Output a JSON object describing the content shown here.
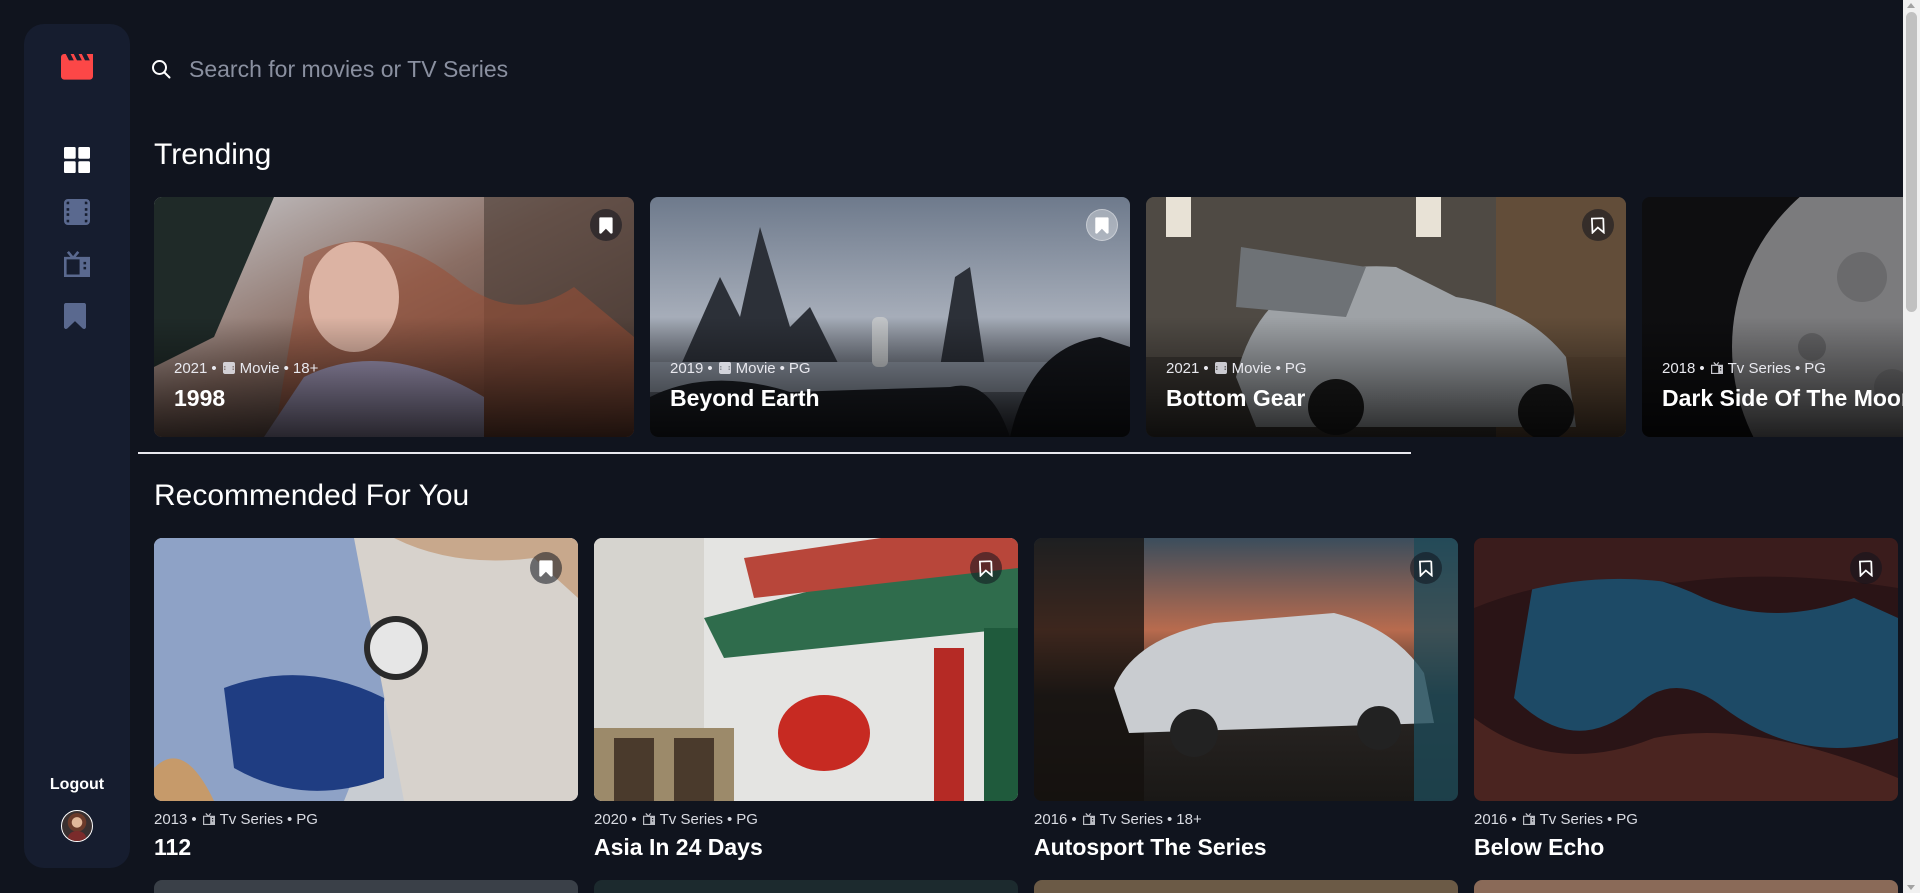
{
  "colors": {
    "background": "#10141e",
    "sidebar": "#161d2f",
    "accent": "#fc4747",
    "nav_active": "#ffffff",
    "nav_inactive": "#5a698f"
  },
  "sidebar": {
    "logo_icon": "film-clapper-icon",
    "nav": [
      {
        "name": "home",
        "icon": "grid-icon",
        "active": true
      },
      {
        "name": "movies",
        "icon": "film-icon",
        "active": false
      },
      {
        "name": "tv-series",
        "icon": "tv-icon",
        "active": false
      },
      {
        "name": "bookmarks",
        "icon": "bookmark-icon",
        "active": false
      }
    ],
    "logout_label": "Logout",
    "avatar_icon": "user-avatar"
  },
  "search": {
    "placeholder": "Search for movies or TV Series",
    "value": ""
  },
  "trending": {
    "title": "Trending",
    "items": [
      {
        "year": "2021",
        "category": "Movie",
        "rating": "18+",
        "title": "1998",
        "bookmarked": true
      },
      {
        "year": "2019",
        "category": "Movie",
        "rating": "PG",
        "title": "Beyond Earth",
        "bookmarked": true
      },
      {
        "year": "2021",
        "category": "Movie",
        "rating": "PG",
        "title": "Bottom Gear",
        "bookmarked": false
      },
      {
        "year": "2018",
        "category": "Tv Series",
        "rating": "PG",
        "title": "Dark Side Of The Moon",
        "bookmarked": false
      }
    ]
  },
  "recommended": {
    "title": "Recommended For You",
    "items": [
      {
        "year": "2013",
        "category": "Tv Series",
        "rating": "PG",
        "title": "112",
        "bookmarked": true
      },
      {
        "year": "2020",
        "category": "Tv Series",
        "rating": "PG",
        "title": "Asia In 24 Days",
        "bookmarked": false
      },
      {
        "year": "2016",
        "category": "Tv Series",
        "rating": "18+",
        "title": "Autosport The Series",
        "bookmarked": false
      },
      {
        "year": "2016",
        "category": "Tv Series",
        "rating": "PG",
        "title": "Below Echo",
        "bookmarked": false
      }
    ]
  }
}
